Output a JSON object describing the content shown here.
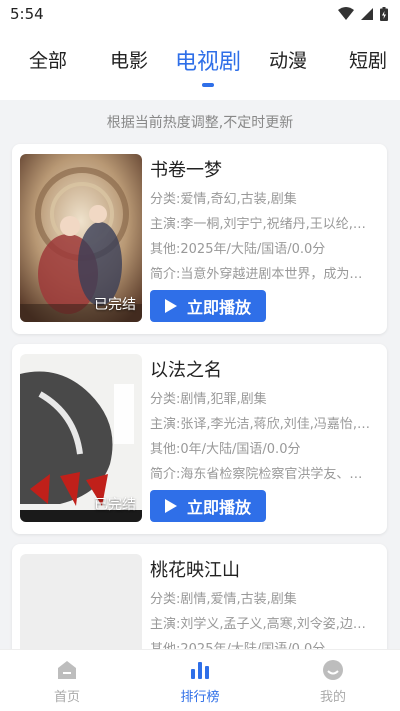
{
  "status": {
    "time": "5:54"
  },
  "tabs": [
    "全部",
    "电影",
    "电视剧",
    "动漫",
    "短剧"
  ],
  "hint": "根据当前热度调整,不定时更新",
  "play_label": "立即播放",
  "items": [
    {
      "title": "书卷一梦",
      "category": "分类:爱情,奇幻,古装,剧集",
      "cast": "主演:李一桐,刘宇宁,祝绪丹,王以纶,…",
      "other": "其他:2025年/大陆/国语/0.0分",
      "intro": "简介:当意外穿越进剧本世界，成为…",
      "badge": "已完结"
    },
    {
      "title": "以法之名",
      "category": "分类:剧情,犯罪,剧集",
      "cast": "主演:张译,李光洁,蒋欣,刘佳,冯嘉怡,…",
      "other": "其他:0年/大陆/国语/0.0分",
      "intro": "简介:海东省检察院检察官洪学友、…",
      "badge": "已完结"
    },
    {
      "title": "桃花映江山",
      "category": "分类:剧情,爱情,古装,剧集",
      "cast": "主演:刘学义,孟子义,高寒,刘令姿,边…",
      "other": "其他:2025年/大陆/国语/0.0分"
    }
  ],
  "nav": [
    "首页",
    "排行榜",
    "我的"
  ],
  "colors": {
    "accent": "#2f6fe8"
  }
}
